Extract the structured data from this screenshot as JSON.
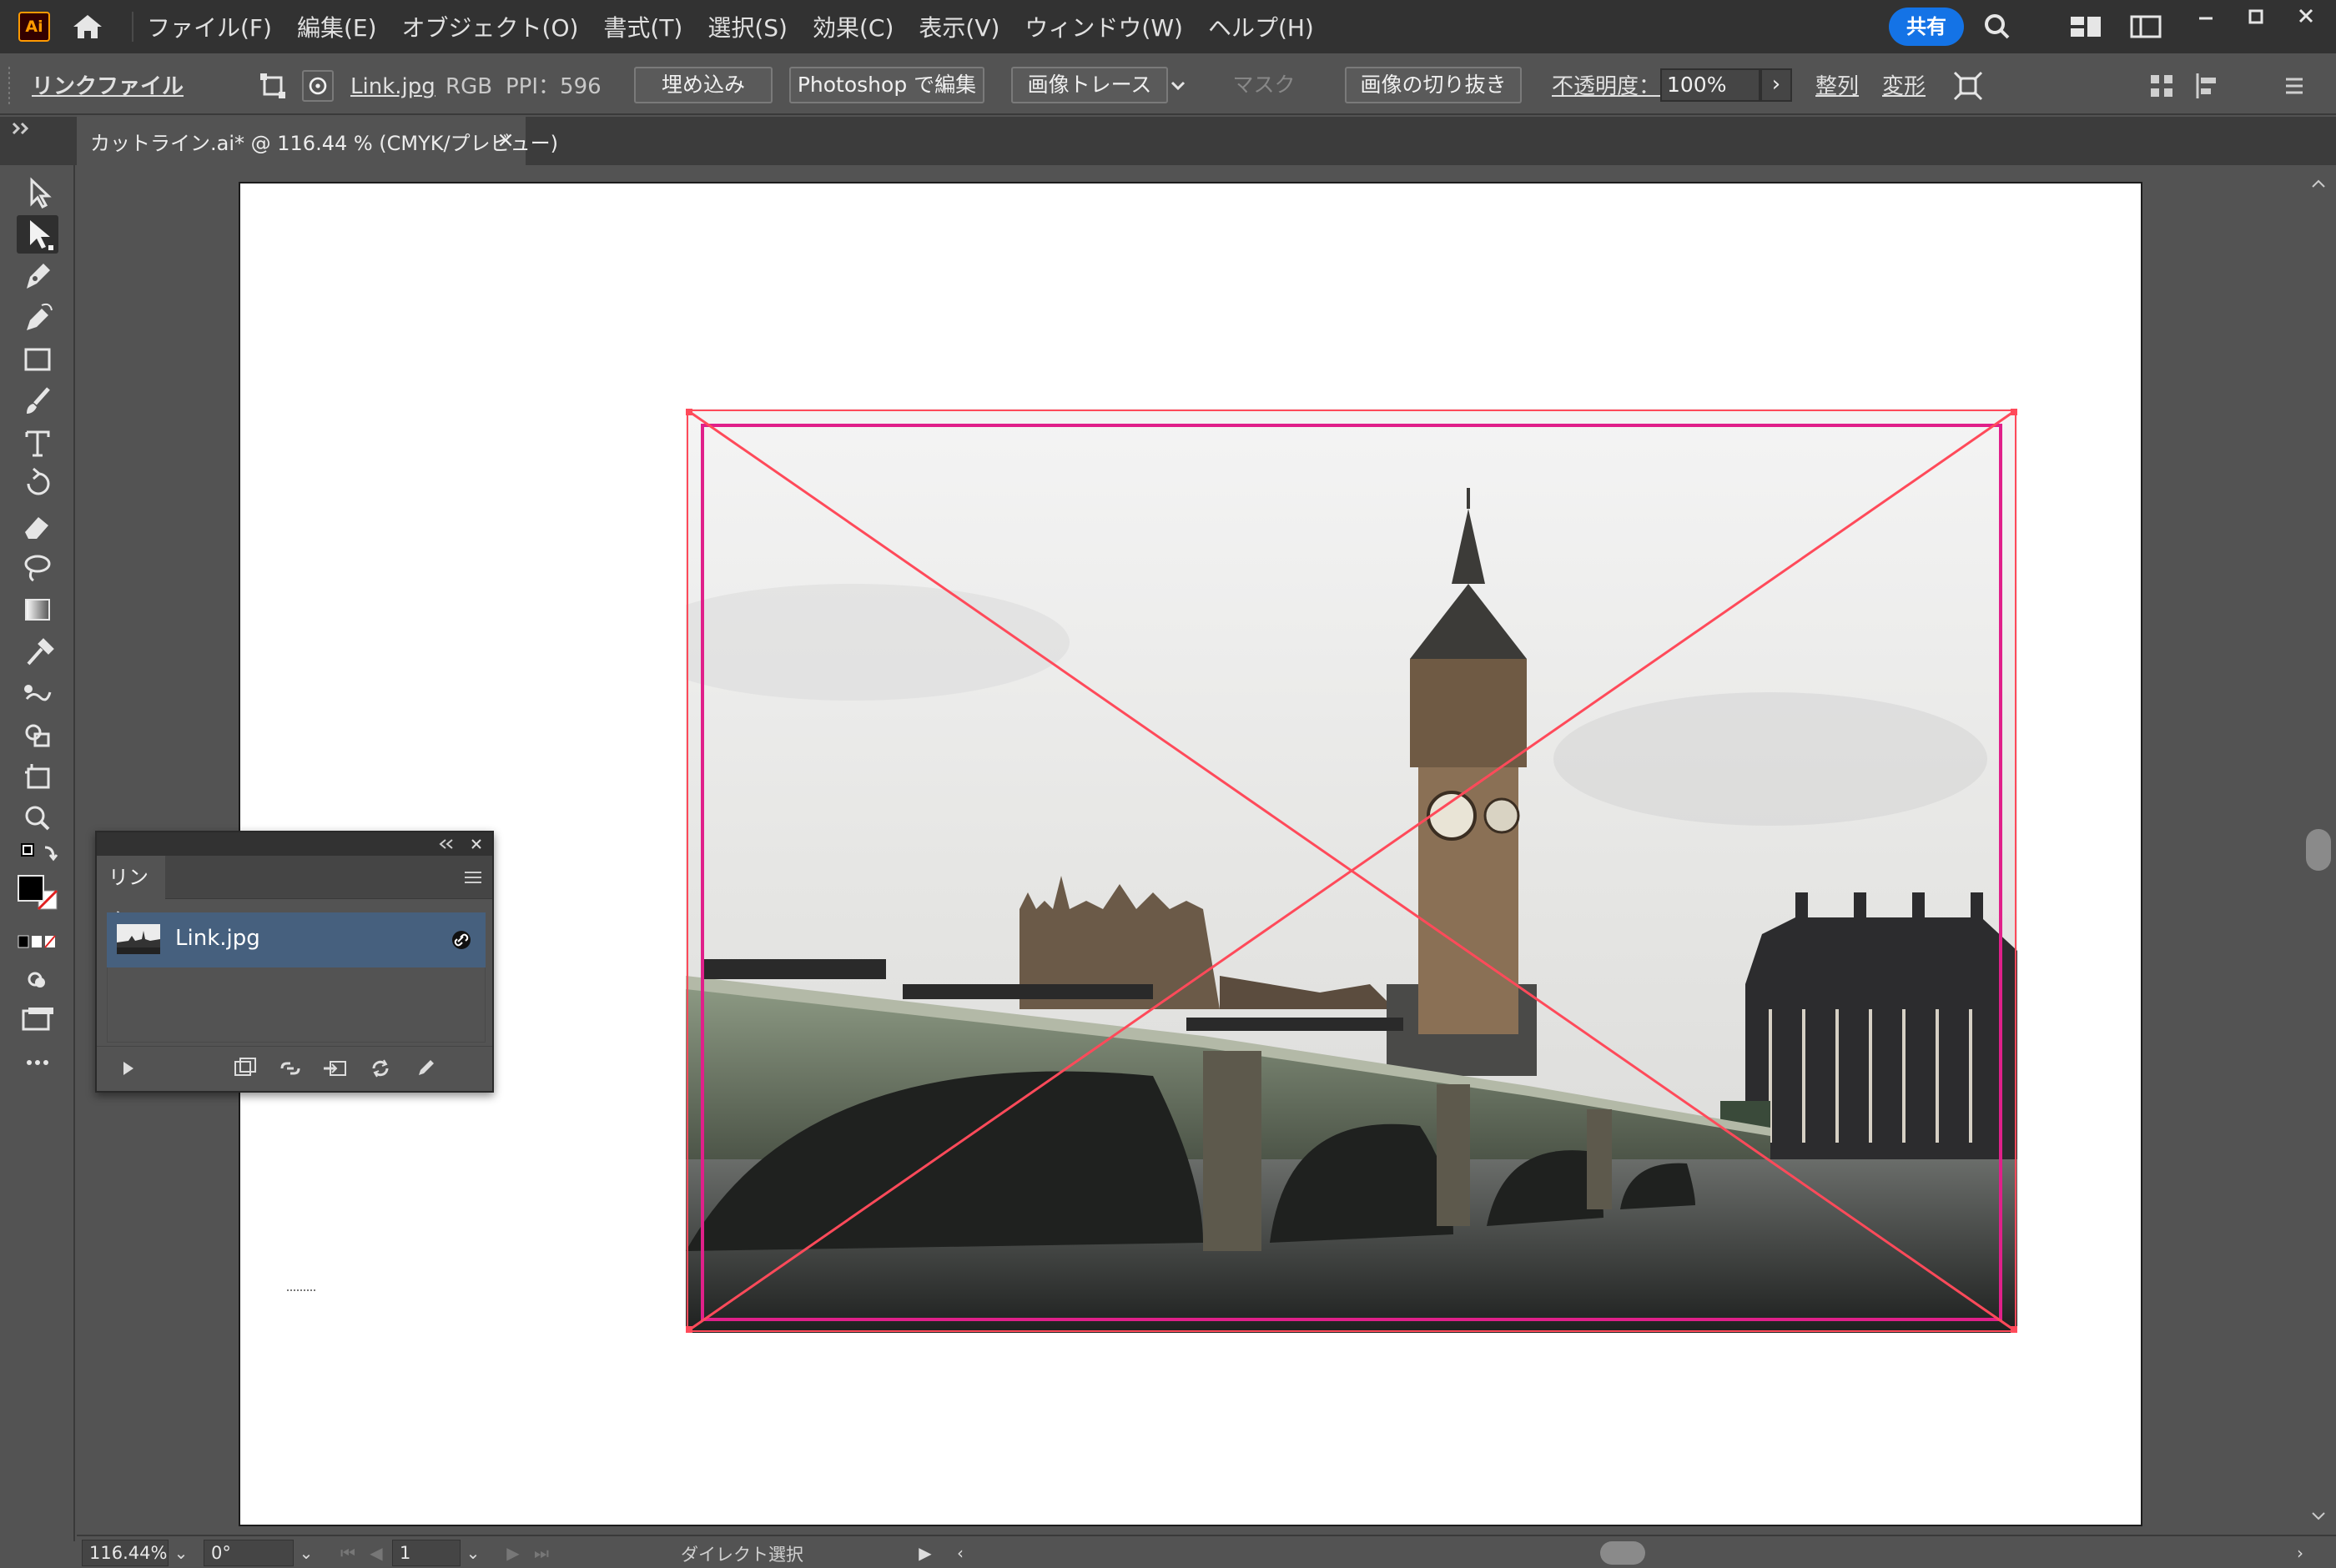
{
  "app": {
    "logo_text": "Ai",
    "menu": [
      "ファイル(F)",
      "編集(E)",
      "オブジェクト(O)",
      "書式(T)",
      "選択(S)",
      "効果(C)",
      "表示(V)",
      "ウィンドウ(W)",
      "ヘルプ(H)"
    ],
    "share_label": "共有"
  },
  "control_bar": {
    "link_file_label": "リンクファイル",
    "filename": "Link.jpg",
    "color_mode": "RGB",
    "ppi": "PPI：596",
    "embed_label": "埋め込み",
    "edit_photoshop_label": "Photoshop で編集",
    "image_trace_label": "画像トレース",
    "mask_label": "マスク",
    "crop_label": "画像の切り抜き",
    "opacity_label": "不透明度：",
    "opacity_value": "100%",
    "align_label": "整列",
    "transform_label": "変形"
  },
  "document_tab": {
    "label": "カットライン.ai* @ 116.44 % (CMYK/プレビュー)",
    "close": "×"
  },
  "links_panel": {
    "tab_label": "リンク",
    "items": [
      {
        "filename": "Link.jpg"
      }
    ]
  },
  "status_bar": {
    "zoom": "116.44%",
    "rotation": "0°",
    "artboard_number": "1",
    "tool_name": "ダイレクト選択"
  },
  "colors": {
    "accent": "#1473e6",
    "selection": "#ff4a5a",
    "crop_frame": "#e0208a",
    "selected_row": "#46607e",
    "logo_fg": "#ff9a00",
    "logo_bg": "#330000"
  },
  "icons": {
    "home": "home-icon",
    "search": "search-icon",
    "tools": [
      "selection-tool-icon",
      "direct-selection-tool-icon",
      "pen-tool-icon",
      "curvature-tool-icon",
      "rectangle-tool-icon",
      "paintbrush-tool-icon",
      "type-tool-icon",
      "rotate-tool-icon",
      "eraser-tool-icon",
      "lasso-tool-icon",
      "gradient-tool-icon",
      "eyedropper-tool-icon",
      "blend-tool-icon",
      "shape-builder-tool-icon",
      "artboard-tool-icon",
      "zoom-tool-icon"
    ]
  }
}
